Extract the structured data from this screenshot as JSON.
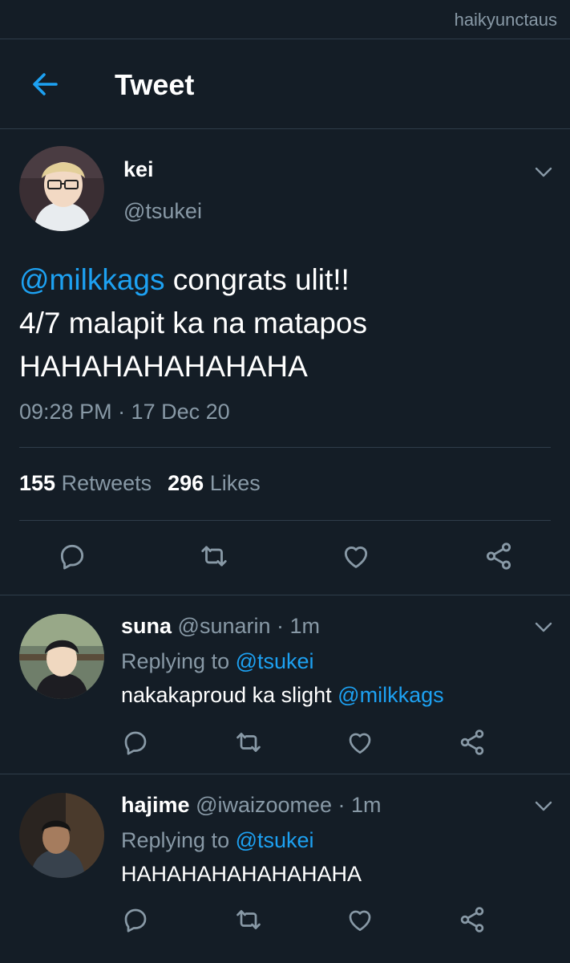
{
  "watermark": "haikyunctaus",
  "header": {
    "title": "Tweet",
    "back_icon": "arrow-left-icon"
  },
  "main_tweet": {
    "name": "kei",
    "handle": "@tsukei",
    "mention": "@milkkags",
    "text_line1_rest": " congrats ulit!!",
    "text_line2": "4/7 malapit ka na matapos",
    "text_line3": "HAHAHAHAHAHAHA",
    "timestamp": "09:28 PM · 17 Dec 20",
    "retweets_count": "155",
    "retweets_label": "Retweets",
    "likes_count": "296",
    "likes_label": "Likes"
  },
  "replies": [
    {
      "name": "suna",
      "handle": "@sunarin",
      "time": " · 1m",
      "replying_prefix": "Replying to ",
      "replying_to": "@tsukei",
      "text": "nakakaproud ka slight ",
      "text_mention": "@milkkags"
    },
    {
      "name": "hajime",
      "handle": "@iwaizoomee",
      "time": " · 1m",
      "replying_prefix": "Replying to ",
      "replying_to": "@tsukei",
      "text": "HAHAHAHAHAHAHAHA",
      "text_mention": ""
    }
  ],
  "icons": [
    "arrow-left-icon",
    "chevron-down-icon",
    "reply-icon",
    "retweet-icon",
    "like-icon",
    "share-icon"
  ],
  "colors": {
    "background": "#141d26",
    "accent": "#1da1f2",
    "muted": "#8899a6",
    "divider": "#2f3d4a"
  }
}
